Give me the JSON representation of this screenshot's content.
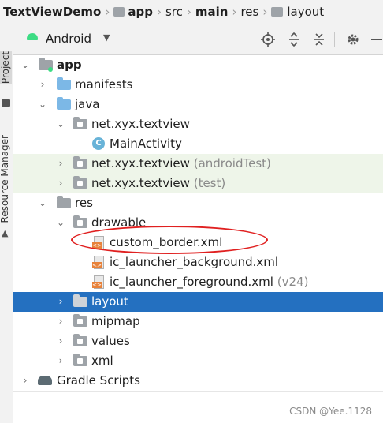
{
  "breadcrumb": [
    {
      "label": "TextViewDemo",
      "bold": true
    },
    {
      "label": "app",
      "bold": true
    },
    {
      "label": "src",
      "bold": false
    },
    {
      "label": "main",
      "bold": true
    },
    {
      "label": "res",
      "bold": false
    },
    {
      "label": "layout",
      "bold": false
    }
  ],
  "side_tabs": {
    "project": "Project",
    "resource_manager": "Resource Manager"
  },
  "panel": {
    "view_mode": "Android"
  },
  "tree": {
    "app": "app",
    "manifests": "manifests",
    "java": "java",
    "pkg_main": "net.xyx.textview",
    "main_activity": "MainActivity",
    "pkg_android_test": "net.xyx.textview",
    "pkg_android_test_hint": "(androidTest)",
    "pkg_test": "net.xyx.textview",
    "pkg_test_hint": "(test)",
    "res": "res",
    "drawable": "drawable",
    "custom_border": "custom_border.xml",
    "ic_launcher_background": "ic_launcher_background.xml",
    "ic_launcher_foreground": "ic_launcher_foreground.xml",
    "ic_launcher_foreground_hint": "(v24)",
    "layout": "layout",
    "mipmap": "mipmap",
    "values": "values",
    "xml": "xml",
    "gradle_scripts": "Gradle Scripts"
  },
  "watermark": "CSDN @Yee.1128",
  "colors": {
    "selection": "#2470c0",
    "test_bg": "#eef5e9",
    "android_green": "#3ddc84",
    "highlight_ellipse": "#e02020"
  }
}
